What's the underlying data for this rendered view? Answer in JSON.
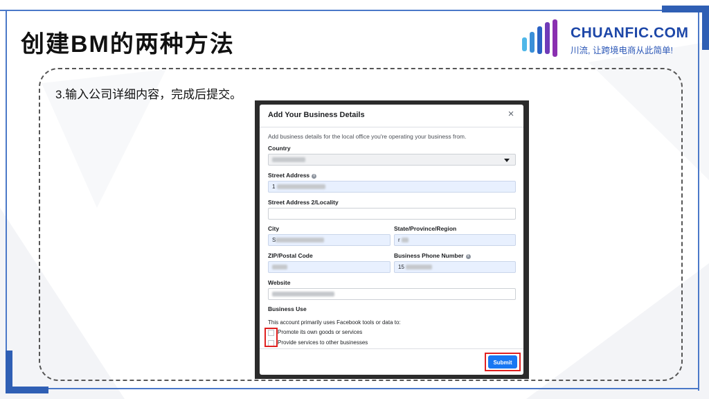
{
  "slide": {
    "title": "创建BM的两种方法",
    "step_text": "3.输入公司详细内容，完成后提交。"
  },
  "logo": {
    "name": "CHUANFIC.COM",
    "slogan": "川流, 让跨境电商从此简单!"
  },
  "colors": {
    "frame_blue": "#2f5fb4",
    "brand_blue": "#1d47a8",
    "submit_blue": "#1877f2",
    "highlight_red": "#e02020"
  },
  "dialog": {
    "title": "Add Your Business Details",
    "close_icon": "×",
    "description": "Add business details for the local office you're operating your business from.",
    "country_label": "Country",
    "street_label": "Street Address",
    "street_value_prefix": "1",
    "street2_label": "Street Address 2/Locality",
    "city_label": "City",
    "city_value_prefix": "S",
    "state_label": "State/Province/Region",
    "state_value_prefix": "r",
    "zip_label": "ZIP/Postal Code",
    "phone_label": "Business Phone Number",
    "phone_value_prefix": "15",
    "website_label": "Website",
    "business_use_label": "Business Use",
    "business_use_question": "This account primarily uses Facebook tools or data to:",
    "option_own_goods": "Promote its own goods or services",
    "option_other_businesses": "Provide services to other businesses",
    "submit_label": "Submit"
  },
  "icons": [
    "close-icon",
    "info-icon",
    "chevron-down-icon",
    "logo-bars-icon"
  ]
}
